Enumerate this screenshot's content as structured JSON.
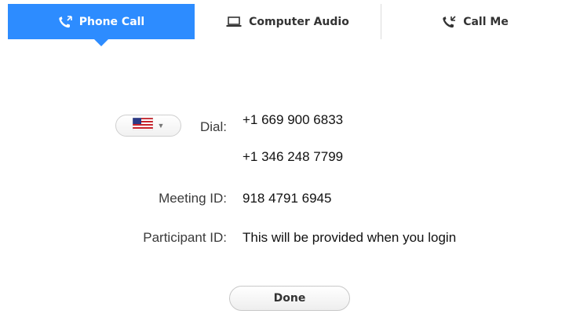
{
  "tabs": [
    {
      "label": "Phone Call",
      "icon": "phone-icon",
      "active": true
    },
    {
      "label": "Computer Audio",
      "icon": "laptop-icon",
      "active": false
    },
    {
      "label": "Call Me",
      "icon": "phone-icon",
      "active": false
    }
  ],
  "dial": {
    "label": "Dial:",
    "numbers": [
      "+1 669 900 6833",
      "+1 346 248 7799"
    ],
    "country_flag": "us-flag-icon"
  },
  "meeting": {
    "label": "Meeting ID:",
    "value": "918 4791 6945"
  },
  "participant": {
    "label": "Participant ID:",
    "value": "This will be provided when you login"
  },
  "done_label": "Done",
  "colors": {
    "accent": "#2d8cff"
  }
}
